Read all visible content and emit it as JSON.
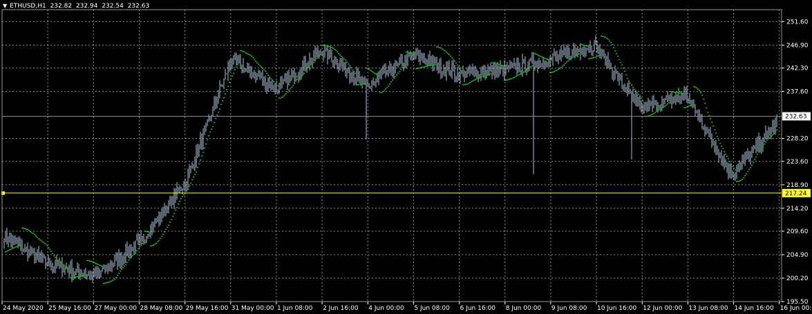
{
  "header": {
    "symbol": "ETHUSD,H1",
    "open": "232.82",
    "high": "232.94",
    "low": "232.54",
    "close": "232.63",
    "arrow_icon": "triangle-down-icon"
  },
  "colors": {
    "background": "#000000",
    "grid": "#c0c0c0",
    "candles": "#b0c4d8",
    "sar": "#1ee81e",
    "hline": "#ffff33",
    "axis_text": "#ffffff",
    "price_badge_bg": "#ffffff",
    "hline_badge_bg": "#ffff33"
  },
  "price_axis": {
    "labels": [
      "251.60",
      "246.90",
      "242.30",
      "237.60",
      "228.20",
      "223.60",
      "218.90",
      "214.20",
      "209.60",
      "204.90",
      "200.20",
      "195.50"
    ],
    "current_price": "232.63",
    "hline_price": "217.24"
  },
  "time_axis": {
    "labels": [
      "24 May 2020",
      "25 May 16:00",
      "27 May 00:00",
      "28 May 08:00",
      "29 May 16:00",
      "31 May 00:00",
      "1 Jun 08:00",
      "2 Jun 16:00",
      "4 Jun 00:00",
      "5 Jun 08:00",
      "6 Jun 16:00",
      "8 Jun 00:00",
      "9 Jun 08:00",
      "10 Jun 16:00",
      "12 Jun 00:00",
      "13 Jun 08:00",
      "14 Jun 16:00",
      "16 Jun 00:00"
    ]
  },
  "chart_data": {
    "type": "line",
    "symbol": "ETHUSD",
    "timeframe": "H1",
    "ylim": [
      195.5,
      254.0
    ],
    "x": [
      "24 May 2020",
      "25 May 16:00",
      "27 May 00:00",
      "28 May 08:00",
      "29 May 16:00",
      "31 May 00:00",
      "1 Jun 08:00",
      "2 Jun 16:00",
      "4 Jun 00:00",
      "5 Jun 08:00",
      "6 Jun 16:00",
      "8 Jun 00:00",
      "9 Jun 08:00",
      "10 Jun 16:00",
      "12 Jun 00:00",
      "13 Jun 08:00",
      "14 Jun 16:00",
      "16 Jun 00:00"
    ],
    "series": [
      {
        "values": [
          208.5,
          203.0,
          200.5,
          207.5,
          219.5,
          244.0,
          238.0,
          246.0,
          238.5,
          245.0,
          241.0,
          242.0,
          244.0,
          247.0,
          234.0,
          237.0,
          221.0,
          231.0
        ]
      }
    ],
    "horizontal_line": 217.24,
    "last_price": 232.63,
    "grid": true
  }
}
